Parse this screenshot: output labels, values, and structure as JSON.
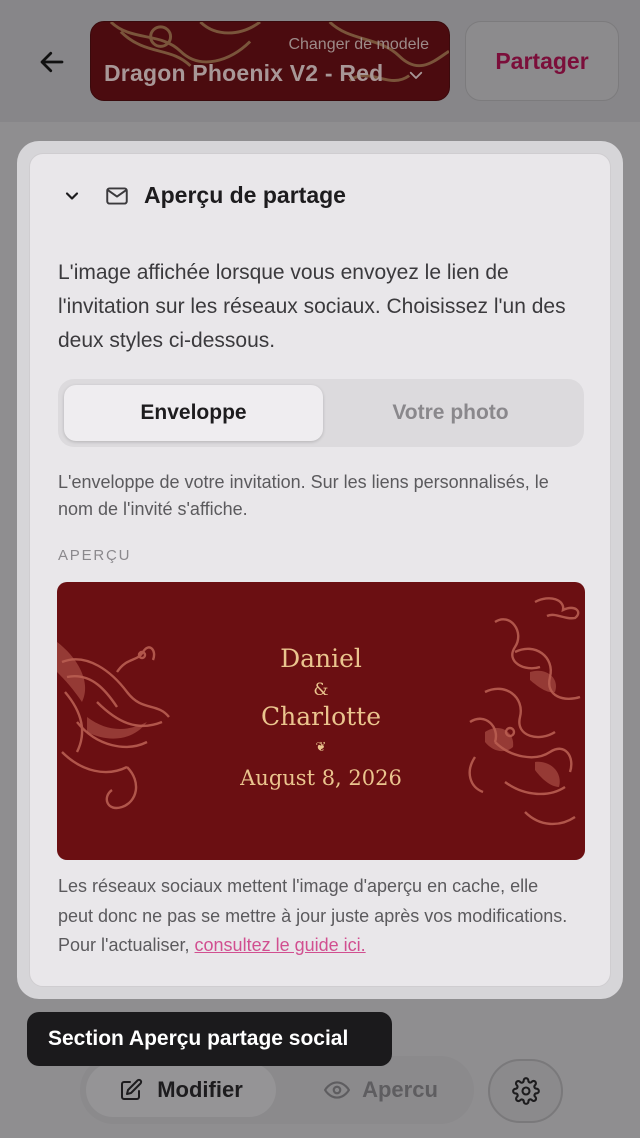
{
  "header": {
    "template_subtitle": "Changer de modele",
    "template_name": "Dragon Phoenix V2 - Red",
    "share_label": "Partager"
  },
  "section": {
    "title": "Aperçu de partage",
    "description": "L'image affichée lorsque vous envoyez le lien de l'invitation sur les réseaux sociaux. Choisissez l'un des deux styles ci-dessous.",
    "options": [
      "Enveloppe",
      "Votre photo"
    ],
    "selected_option": "Enveloppe",
    "hint": "L'enveloppe de votre invitation. Sur les liens personnalisés, le nom de l'invité s'affiche.",
    "preview_label": "APERÇU",
    "envelope": {
      "name1": "Daniel",
      "ampersand": "&",
      "name2": "Charlotte",
      "ornament": "❦",
      "date": "August 8, 2026"
    },
    "note": "Les réseaux sociaux mettent l'image d'aperçu en cache, elle peut donc ne pas se mettre à jour juste après vos modifications. Pour l'actualiser,",
    "note_link": "consultez le guide ici."
  },
  "toast": "Section Aperçu partage social",
  "bottom_nav": {
    "edit_label": "Modifier",
    "preview_label": "Apercu"
  },
  "colors": {
    "envelope_bg": "#6b0f12",
    "envelope_text": "#eac48e",
    "link": "#d14f90",
    "share_text": "#7b0e3a"
  },
  "icons": [
    "arrow-left-icon",
    "chevron-down-icon",
    "mail-icon",
    "pencil-square-icon",
    "eye-icon",
    "gear-icon"
  ]
}
